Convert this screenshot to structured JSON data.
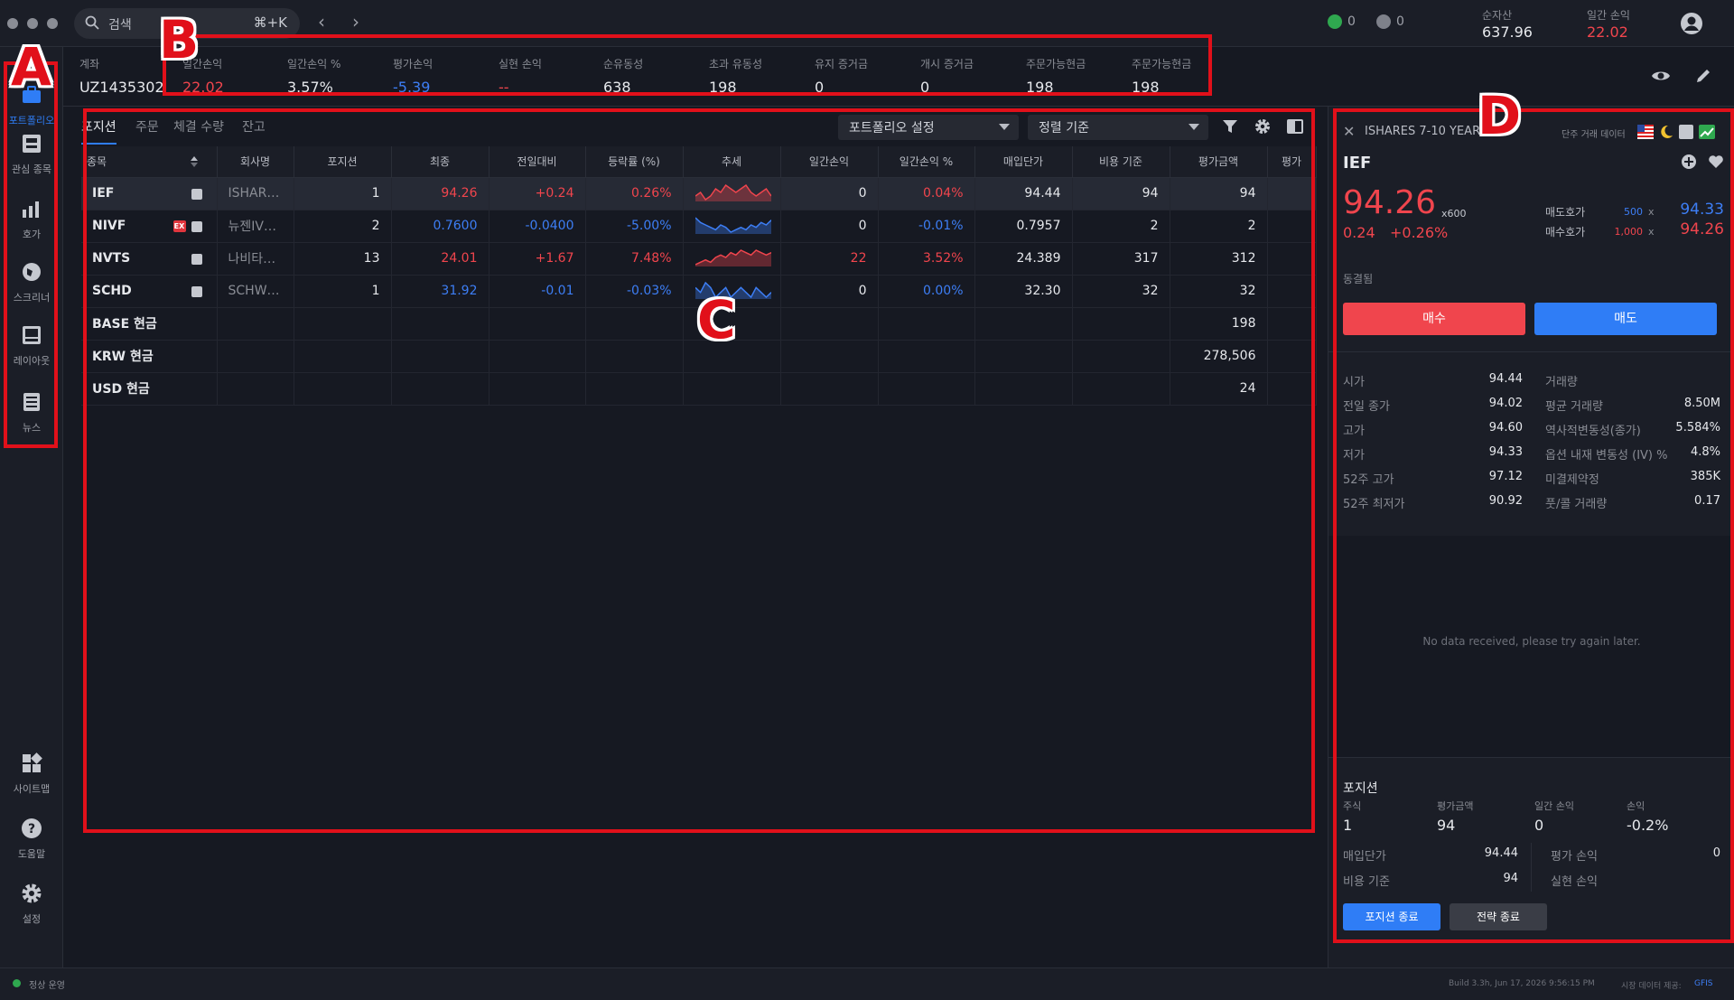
{
  "titlebar": {
    "search_placeholder": "검색",
    "search_shortcut": "⌘+K",
    "status_green_count": "0",
    "status_gray_count": "0",
    "net_assets_label": "순자산",
    "net_assets_value": "637.96",
    "daily_pnl_label": "일간 손익",
    "daily_pnl_value": "22.02"
  },
  "sidebar": {
    "items": [
      {
        "label": "포트폴리오",
        "icon": "portfolio-icon"
      },
      {
        "label": "관심 종목",
        "icon": "watchlist-icon"
      },
      {
        "label": "호가",
        "icon": "quote-icon"
      },
      {
        "label": "스크리너",
        "icon": "screener-icon"
      },
      {
        "label": "레이아웃",
        "icon": "layout-icon"
      },
      {
        "label": "뉴스",
        "icon": "news-icon"
      }
    ],
    "bottom_items": [
      {
        "label": "사이트맵",
        "icon": "sitemap-icon"
      },
      {
        "label": "도움말",
        "icon": "help-icon"
      },
      {
        "label": "설정",
        "icon": "settings-icon"
      }
    ]
  },
  "account": {
    "label": "계좌",
    "id": "UZ1435302",
    "metrics": [
      {
        "label": "일간손익",
        "value": "22.02"
      },
      {
        "label": "일간손익 %",
        "value": "3.57%"
      },
      {
        "label": "평가손익",
        "value": "-5.39"
      },
      {
        "label": "실현 손익",
        "value": "--"
      },
      {
        "label": "순유동성",
        "value": "638"
      },
      {
        "label": "초과 유동성",
        "value": "198"
      },
      {
        "label": "유지 증거금",
        "value": "0"
      },
      {
        "label": "개시 증거금",
        "value": "0"
      },
      {
        "label": "주문가능현금",
        "value": "198"
      },
      {
        "label": "주문가능현금",
        "value": "198"
      }
    ]
  },
  "positions": {
    "tabs": [
      "포지션",
      "주문",
      "체결 수량",
      "잔고"
    ],
    "portfolio_settings": "포트폴리오 설정",
    "sort_by": "정렬 기준",
    "columns": [
      "종목",
      "회사명",
      "포지션",
      "최종",
      "전일대비",
      "등락률 (%)",
      "추세",
      "일간손익",
      "일간손익 %",
      "매입단가",
      "비용 기준",
      "평가금액",
      "평가"
    ],
    "rows": [
      {
        "symbol": "IEF",
        "company": "ISHAR…",
        "position": "1",
        "last": "94.26",
        "change": "+0.24",
        "change_pct": "0.26%",
        "daily_pnl": "0",
        "daily_pnl_pct": "0.04%",
        "avg_price": "94.44",
        "cost_basis": "94",
        "market_value": "94"
      },
      {
        "symbol": "NIVF",
        "company": "뉴젠IV…",
        "position": "2",
        "last": "0.7600",
        "change": "-0.0400",
        "change_pct": "-5.00%",
        "daily_pnl": "0",
        "daily_pnl_pct": "-0.01%",
        "avg_price": "0.7957",
        "cost_basis": "2",
        "market_value": "2"
      },
      {
        "symbol": "NVTS",
        "company": "나비타…",
        "position": "13",
        "last": "24.01",
        "change": "+1.67",
        "change_pct": "7.48%",
        "daily_pnl": "22",
        "daily_pnl_pct": "3.52%",
        "avg_price": "24.389",
        "cost_basis": "317",
        "market_value": "312"
      },
      {
        "symbol": "SCHD",
        "company": "SCHW…",
        "position": "1",
        "last": "31.92",
        "change": "-0.01",
        "change_pct": "-0.03%",
        "daily_pnl": "0",
        "daily_pnl_pct": "0.00%",
        "avg_price": "32.30",
        "cost_basis": "32",
        "market_value": "32"
      }
    ],
    "cash_rows": [
      {
        "label": "BASE 현금",
        "value": "198"
      },
      {
        "label": "KRW 현금",
        "value": "278,506"
      },
      {
        "label": "USD 현금",
        "value": "24"
      }
    ],
    "tag_label": "EX"
  },
  "detail": {
    "title": "ISHARES 7-10 YEAR ...",
    "short_sale_label": "단주 거래 데이터",
    "symbol": "IEF",
    "price": "94.26",
    "multiplier": "x600",
    "change": "0.24",
    "change_pct": "+0.26%",
    "ask_label": "매도호가",
    "ask_size": "500",
    "ask_price": "94.33",
    "bid_label": "매수호가",
    "bid_size": "1,000",
    "bid_price": "94.26",
    "times_sign": "x",
    "synced_label": "동결됨",
    "buy_label": "매수",
    "sell_label": "매도",
    "stats_left": [
      {
        "label": "시가",
        "value": "94.44"
      },
      {
        "label": "전일 종가",
        "value": "94.02"
      },
      {
        "label": "고가",
        "value": "94.60"
      },
      {
        "label": "저가",
        "value": "94.33"
      },
      {
        "label": "52주 고가",
        "value": "97.12"
      },
      {
        "label": "52주 최저가",
        "value": "90.92"
      }
    ],
    "stats_right": [
      {
        "label": "거래량",
        "value": ""
      },
      {
        "label": "평균 거래량",
        "value": "8.50M"
      },
      {
        "label": "역사적변동성(종가)",
        "value": "5.584%"
      },
      {
        "label": "옵션 내재 변동성 (IV) %",
        "value": "4.8%"
      },
      {
        "label": "미결제약정",
        "value": "385K"
      },
      {
        "label": "풋/콜 거래량",
        "value": "0.17"
      }
    ],
    "no_data": "No data received, please try again later.",
    "position_title": "포지션",
    "pos_headers": [
      "주식",
      "평가금액",
      "일간 손익",
      "손익"
    ],
    "pos_values": [
      "1",
      "94",
      "0",
      "-0.2%"
    ],
    "pos_left": [
      {
        "label": "매입단가",
        "value": "94.44"
      },
      {
        "label": "비용 기준",
        "value": "94"
      }
    ],
    "pos_right": [
      {
        "label": "평가 손익",
        "value": "0"
      },
      {
        "label": "실현 손익",
        "value": ""
      }
    ],
    "close_position": "포지션 종료",
    "close_strategy": "전략 종료"
  },
  "status": {
    "state": "정상 운영",
    "build": "Build 3.3h, Jun 17, 2026 9:56:15 PM",
    "market_data": "시장 데이터 제공:",
    "provider": "GFIS"
  },
  "annotations": {
    "a": "A",
    "b": "B",
    "c": "C",
    "d": "D"
  },
  "colors": {
    "accent_red": "#f0454d",
    "accent_blue": "#3d7ef5",
    "annotation": "#e1101a"
  },
  "sparklines": {
    "IEF": [
      5,
      6,
      4,
      5,
      7,
      6,
      8,
      7,
      6,
      7,
      8,
      6,
      5,
      6,
      7,
      5
    ],
    "NIVF": [
      8,
      6,
      5,
      4,
      3,
      5,
      4,
      2,
      3,
      4,
      3,
      5,
      4,
      6,
      5,
      7
    ],
    "NVTS": [
      2,
      3,
      4,
      3,
      5,
      6,
      5,
      7,
      6,
      8,
      7,
      6,
      8,
      7,
      6,
      7
    ],
    "SCHD": [
      6,
      5,
      7,
      6,
      4,
      5,
      6,
      4,
      5,
      6,
      5,
      4,
      6,
      5,
      4,
      5
    ]
  }
}
